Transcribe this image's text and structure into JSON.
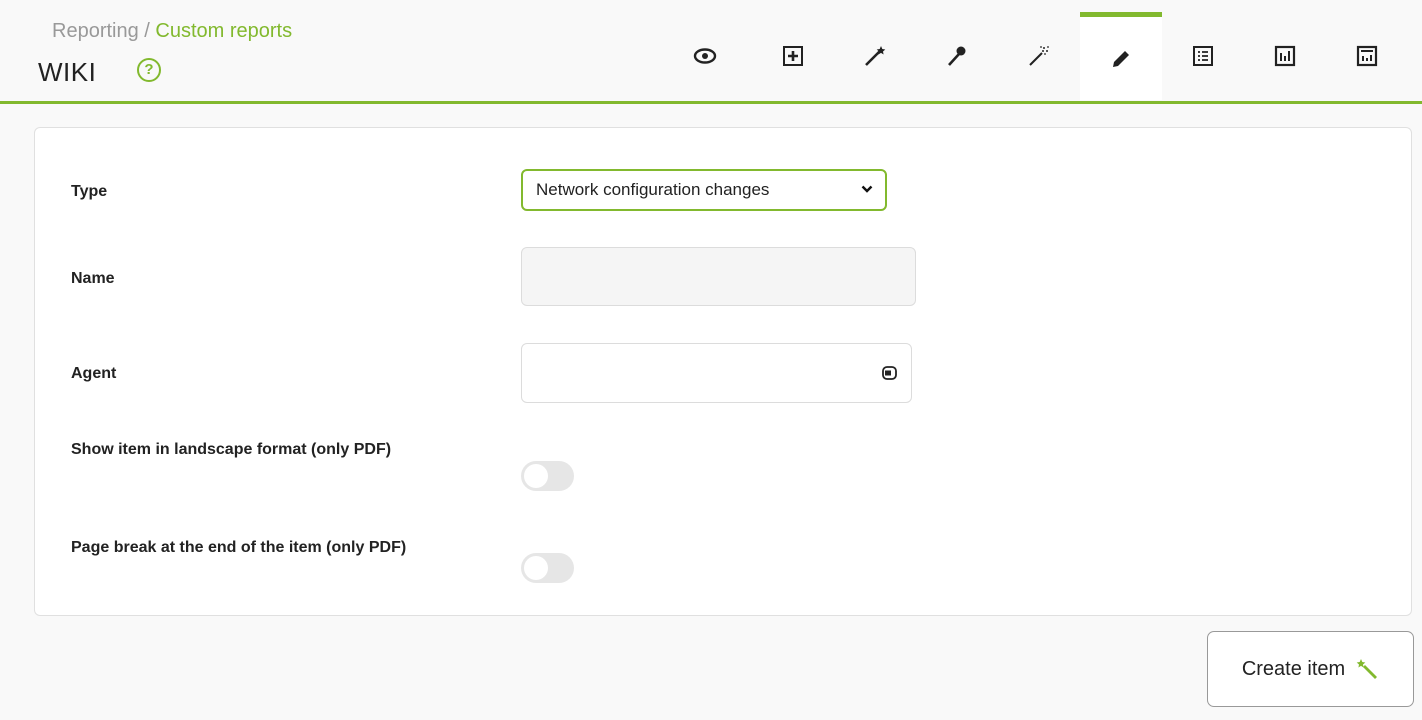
{
  "header": {
    "breadcrumb": {
      "parent": "Reporting",
      "separator": " / ",
      "current": "Custom reports"
    },
    "title": "WIKI",
    "help_icon": "?",
    "toolbar": [
      {
        "icon": "eye-icon",
        "active": false
      },
      {
        "icon": "add-box-icon",
        "active": false
      },
      {
        "icon": "wand-icon",
        "active": false
      },
      {
        "icon": "pin-icon",
        "active": false
      },
      {
        "icon": "magic-wand-sparkle-icon",
        "active": false
      },
      {
        "icon": "pencil-icon",
        "active": true
      },
      {
        "icon": "list-icon",
        "active": false
      },
      {
        "icon": "bar-chart-icon",
        "active": false
      },
      {
        "icon": "report-icon",
        "active": false
      }
    ]
  },
  "form": {
    "type_label": "Type",
    "type_value": "Network configuration changes",
    "name_label": "Name",
    "name_value": "",
    "agent_label": "Agent",
    "agent_value": "",
    "landscape_label": "Show item in landscape format (only PDF)",
    "landscape_enabled": false,
    "pagebreak_label": "Page break at the end of the item (only PDF)",
    "pagebreak_enabled": false
  },
  "actions": {
    "create_label": "Create item"
  },
  "colors": {
    "accent": "#82b92e",
    "toggle_off": "#e6e6e6"
  }
}
